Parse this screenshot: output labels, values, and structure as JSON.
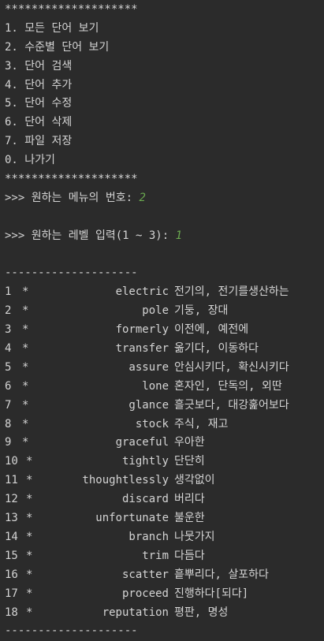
{
  "menu": {
    "border_top": "********************",
    "items": [
      "1. 모든 단어 보기",
      "2. 수준별 단어 보기",
      "3. 단어 검색",
      "4. 단어 추가",
      "5. 단어 수정",
      "6. 단어 삭제",
      "7. 파일 저장",
      "0. 나가기"
    ],
    "border_bottom": "********************"
  },
  "prompt_menu": {
    "label": ">>> 원하는 메뉴의 번호: ",
    "value": "2"
  },
  "prompt_level": {
    "label": ">>> 원하는 레벨 입력(1 ~ 3): ",
    "value": "1"
  },
  "list": {
    "divider_top": "--------------------",
    "star": "*",
    "words": [
      {
        "no": "1",
        "word": "electric",
        "meaning": "전기의, 전기를생산하는"
      },
      {
        "no": "2",
        "word": "pole",
        "meaning": "기둥, 장대"
      },
      {
        "no": "3",
        "word": "formerly",
        "meaning": "이전에, 예전에"
      },
      {
        "no": "4",
        "word": "transfer",
        "meaning": "옮기다, 이동하다"
      },
      {
        "no": "5",
        "word": "assure",
        "meaning": "안심시키다, 확신시키다"
      },
      {
        "no": "6",
        "word": "lone",
        "meaning": "혼자인, 단독의, 외딴"
      },
      {
        "no": "7",
        "word": "glance",
        "meaning": "흘긋보다, 대강훑어보다"
      },
      {
        "no": "8",
        "word": "stock",
        "meaning": "주식, 재고"
      },
      {
        "no": "9",
        "word": "graceful",
        "meaning": "우아한"
      },
      {
        "no": "10",
        "word": "tightly",
        "meaning": "단단히"
      },
      {
        "no": "11",
        "word": "thoughtlessly",
        "meaning": "생각없이"
      },
      {
        "no": "12",
        "word": "discard",
        "meaning": "버리다"
      },
      {
        "no": "13",
        "word": "unfortunate",
        "meaning": "불운한"
      },
      {
        "no": "14",
        "word": "branch",
        "meaning": "나뭇가지"
      },
      {
        "no": "15",
        "word": "trim",
        "meaning": "다듬다"
      },
      {
        "no": "16",
        "word": "scatter",
        "meaning": "흩뿌리다, 살포하다"
      },
      {
        "no": "17",
        "word": "proceed",
        "meaning": "진행하다[되다]"
      },
      {
        "no": "18",
        "word": "reputation",
        "meaning": "평판, 명성"
      }
    ],
    "divider_bottom": "--------------------"
  },
  "colors": {
    "background": "#2b2b2b",
    "text": "#d4d4d4",
    "input": "#6aa84f"
  }
}
